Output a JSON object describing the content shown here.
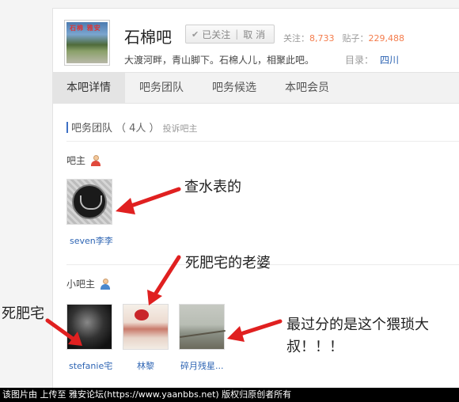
{
  "forum": {
    "title": "石棉吧",
    "avatar_text": "石棉 雅安",
    "follow_label": "已关注",
    "cancel_label": "取 消",
    "followers_label": "关注：",
    "followers": "8,733",
    "posts_label": "贴子：",
    "posts": "229,488",
    "slogan": "大渡河畔，青山脚下。石棉人儿，相聚此吧。",
    "catalog_label": "目录：",
    "catalog_value": "四川"
  },
  "tabs": [
    {
      "label": "本吧详情"
    },
    {
      "label": "吧务团队"
    },
    {
      "label": "吧务候选"
    },
    {
      "label": "本吧会员"
    }
  ],
  "team": {
    "title": "吧务团队",
    "count": "（ 4人 ）",
    "complain": "投诉吧主",
    "owner_label": "吧主",
    "assistant_label": "小吧主",
    "owners": [
      {
        "name": "seven李李"
      }
    ],
    "assistants": [
      {
        "name": "stefanie宅"
      },
      {
        "name": "林黎"
      },
      {
        "name": "碎月残星..."
      }
    ]
  },
  "annotations": {
    "owner": "查水表的",
    "assistant_lover": "死肥宅的老婆",
    "fat_otaku": "死肥宅",
    "worst_line1": "最过分的是这个猥琐大",
    "worst_line2": "叔！！！"
  },
  "footer": {
    "text": "该图片由 上传至 雅安论坛(https://www.yaanbbs.net) 版权归原创者所有"
  },
  "colors": {
    "link": "#2d64b3",
    "stat_number": "#f47c4c",
    "arrow": "#e02020",
    "section_bar": "#3d70c4"
  }
}
